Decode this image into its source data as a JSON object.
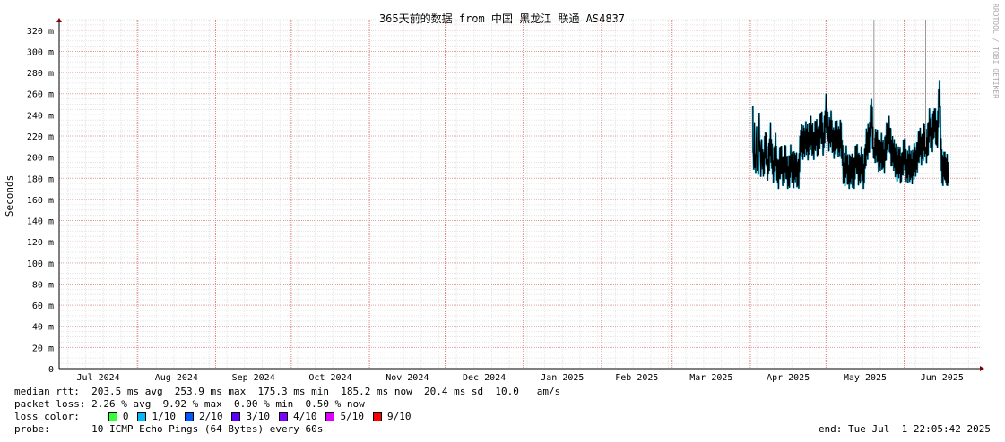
{
  "chart_data": {
    "type": "line",
    "title": "365天前的数据 from 中国 黑龙江 联通 AS4837",
    "ylabel": "Seconds",
    "y_ticks": [
      "0",
      "20 m",
      "40 m",
      "60 m",
      "80 m",
      "100 m",
      "120 m",
      "140 m",
      "160 m",
      "180 m",
      "200 m",
      "220 m",
      "240 m",
      "260 m",
      "280 m",
      "300 m",
      "320 m"
    ],
    "ylim": [
      0,
      330
    ],
    "x_ticks": [
      "Jul 2024",
      "Aug 2024",
      "Sep 2024",
      "Oct 2024",
      "Nov 2024",
      "Dec 2024",
      "Jan 2025",
      "Feb 2025",
      "Mar 2025",
      "Apr 2025",
      "May 2025",
      "Jun 2025"
    ],
    "grid": true,
    "series": [
      {
        "name": "median rtt",
        "color": "#000000",
        "smoke_color": "#00b0e0",
        "points": [
          [
            275.0,
            240
          ],
          [
            275.2,
            190
          ],
          [
            275.6,
            222
          ],
          [
            276.0,
            185
          ],
          [
            276.5,
            215
          ],
          [
            277.0,
            182
          ],
          [
            277.5,
            225
          ],
          [
            278.0,
            192
          ],
          [
            278.5,
            208
          ],
          [
            279.0,
            185
          ],
          [
            280.0,
            212
          ],
          [
            281.0,
            190
          ],
          [
            282.0,
            218
          ],
          [
            283.0,
            186
          ],
          [
            284.0,
            205
          ],
          [
            285.0,
            183
          ],
          [
            286.0,
            200
          ],
          [
            287.0,
            184
          ],
          [
            288.0,
            198
          ],
          [
            289.0,
            182
          ],
          [
            290.0,
            196
          ],
          [
            291.0,
            184
          ],
          [
            292.0,
            194
          ],
          [
            293.0,
            183
          ],
          [
            294.0,
            215
          ],
          [
            295.0,
            212
          ],
          [
            296.0,
            220
          ],
          [
            297.0,
            214
          ],
          [
            298.0,
            222
          ],
          [
            299.0,
            211
          ],
          [
            300.0,
            225
          ],
          [
            301.0,
            213
          ],
          [
            302.0,
            230
          ],
          [
            303.0,
            215
          ],
          [
            304.0,
            245
          ],
          [
            305.0,
            218
          ],
          [
            306.0,
            226
          ],
          [
            307.0,
            214
          ],
          [
            308.0,
            222
          ],
          [
            309.0,
            212
          ],
          [
            310.0,
            220
          ],
          [
            311.0,
            186
          ],
          [
            312.0,
            195
          ],
          [
            313.0,
            181
          ],
          [
            314.0,
            192
          ],
          [
            315.0,
            184
          ],
          [
            316.0,
            200
          ],
          [
            317.0,
            186
          ],
          [
            318.0,
            196
          ],
          [
            319.0,
            184
          ],
          [
            320.0,
            210
          ],
          [
            321.0,
            215
          ],
          [
            322.0,
            246
          ],
          [
            323.0,
            205
          ],
          [
            324.0,
            212
          ],
          [
            325.0,
            200
          ],
          [
            326.0,
            208
          ],
          [
            327.0,
            196
          ],
          [
            328.0,
            215
          ],
          [
            329.0,
            225
          ],
          [
            330.0,
            206
          ],
          [
            331.0,
            200
          ],
          [
            332.0,
            192
          ],
          [
            333.0,
            198
          ],
          [
            334.0,
            188
          ],
          [
            335.0,
            205
          ],
          [
            336.0,
            190
          ],
          [
            337.0,
            196
          ],
          [
            338.0,
            187
          ],
          [
            339.0,
            195
          ],
          [
            340.0,
            200
          ],
          [
            341.0,
            215
          ],
          [
            342.0,
            205
          ],
          [
            343.0,
            218
          ],
          [
            344.0,
            210
          ],
          [
            345.0,
            230
          ],
          [
            346.0,
            216
          ],
          [
            347.0,
            238
          ],
          [
            348.0,
            220
          ],
          [
            349.0,
            262
          ],
          [
            349.6,
            200
          ],
          [
            350.2,
            188
          ],
          [
            350.8,
            195
          ],
          [
            351.4,
            183
          ],
          [
            352.0,
            190
          ],
          [
            352.6,
            185
          ]
        ]
      }
    ]
  },
  "stats": {
    "median_rtt": "median rtt:  203.5 ms avg  253.9 ms max  175.3 ms min  185.2 ms now  20.4 ms sd  10.0   am/s",
    "packet_loss": "packet loss: 2.26 % avg  9.92 % max  0.00 % min  0.50 % now",
    "loss_color_label": "loss color:",
    "loss_colors": [
      {
        "label": "0",
        "color": "#33ff33"
      },
      {
        "label": "1/10",
        "color": "#00b8ff"
      },
      {
        "label": "2/10",
        "color": "#0059ff"
      },
      {
        "label": "3/10",
        "color": "#5e00ff"
      },
      {
        "label": "4/10",
        "color": "#7e00ff"
      },
      {
        "label": "5/10",
        "color": "#dd00ff"
      },
      {
        "label": "9/10",
        "color": "#ff0000"
      }
    ],
    "probe": "probe:       10 ICMP Echo Pings (64 Bytes) every 60s",
    "end": "end: Tue Jul  1 22:05:42 2025"
  },
  "watermark": "RRDTOOL / TOBI OETIKER"
}
